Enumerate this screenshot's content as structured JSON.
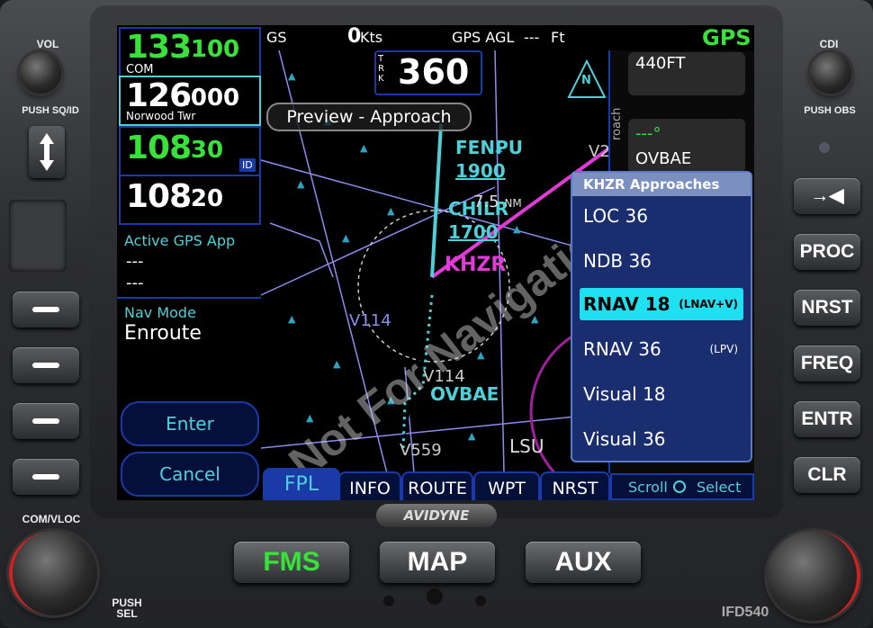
{
  "left_knob": {
    "label": "VOL",
    "push_label": "PUSH SQ/ID"
  },
  "right_knob": {
    "label": "CDI",
    "push_label": "PUSH OBS"
  },
  "bottom_left_knob": {
    "label": "COM/VLOC",
    "push_label": "PUSH\nSEL"
  },
  "right_buttons": [
    "→◀",
    "PROC",
    "NRST",
    "FREQ",
    "ENTR",
    "CLR"
  ],
  "bottom_buttons": {
    "fms": "FMS",
    "map": "MAP",
    "aux": "AUX"
  },
  "brand": "AVIDYNE",
  "model": "IFD540",
  "com_active": {
    "mhz": "133",
    "khz": ".100",
    "label": "COM"
  },
  "com_standby": {
    "mhz": "126",
    "khz": ".000",
    "label": "Norwood Twr"
  },
  "nav_active": {
    "mhz": "108",
    "khz": ".30",
    "badge": "ID"
  },
  "nav_standby": {
    "mhz": "108",
    "khz": ".20"
  },
  "active_gps_app": {
    "title": "Active GPS App",
    "line1": "---",
    "line2": "---"
  },
  "nav_mode": {
    "title": "Nav Mode",
    "value": "Enroute"
  },
  "left_actions": {
    "enter": "Enter",
    "cancel": "Cancel"
  },
  "topbar": {
    "gs_label": "GS",
    "gs_value": "0",
    "gs_unit": "Kts",
    "agl_label": "GPS AGL",
    "agl_value": "---",
    "agl_unit": "Ft",
    "mode": "GPS"
  },
  "map": {
    "track_label": "TRK",
    "track_value": "360",
    "preview_banner": "Preview - Approach",
    "north": "N",
    "watermark": "Not For Navigation",
    "labels": {
      "fenpu": "FENPU",
      "alt1900": "1900",
      "chilr": "CHILR",
      "alt1700": "1700",
      "khzr": "KHZR",
      "v114a": "V114",
      "v114b": "V114",
      "ovbae": "OVBAE",
      "v559": "V559",
      "lsu": "LSU",
      "range": "7.5",
      "nm": "NM",
      "v2": "V2"
    }
  },
  "right_panel": {
    "altitude": "440FT",
    "course": "---°",
    "waypoint": "OVBAE",
    "side_label": "roach"
  },
  "menu": {
    "title": "KHZR Approaches",
    "items": [
      {
        "label": "LOC 36",
        "sub": "",
        "selected": false
      },
      {
        "label": "NDB 36",
        "sub": "",
        "selected": false
      },
      {
        "label": "RNAV 18",
        "sub": "(LNAV+V)",
        "selected": true
      },
      {
        "label": "RNAV 36",
        "sub": "(LPV)",
        "selected": false
      },
      {
        "label": "Visual 18",
        "sub": "",
        "selected": false
      },
      {
        "label": "Visual 36",
        "sub": "",
        "selected": false
      }
    ]
  },
  "tabs": [
    "FPL",
    "INFO",
    "ROUTE",
    "WPT",
    "NRST"
  ],
  "hint": {
    "scroll": "Scroll",
    "select": "Select"
  },
  "colors": {
    "green": "#39e23a",
    "cyan": "#4fd0d8",
    "magenta": "#e23ad8",
    "navy": "#05103a"
  }
}
